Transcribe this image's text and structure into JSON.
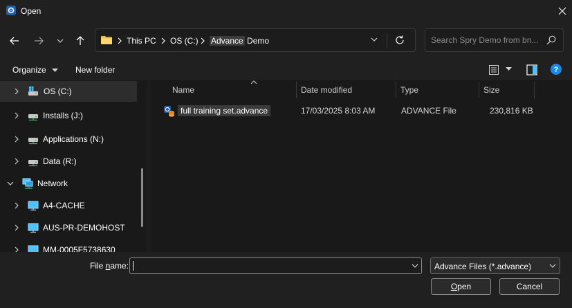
{
  "window": {
    "title": "Open",
    "app_icon": "advance-app-icon",
    "close_icon": "close-icon"
  },
  "nav": {
    "back_icon": "arrow-left-icon",
    "forward_icon": "arrow-right-icon",
    "recent_icon": "chevron-down-icon",
    "up_icon": "arrow-up-icon",
    "breadcrumbs": [
      "This PC",
      "OS (C:)",
      "Advance",
      "Demo"
    ],
    "search_placeholder": "Search Spry Demo from bn..."
  },
  "commands": {
    "organize": "Organize",
    "new_folder": "New folder"
  },
  "sidebar": {
    "items": [
      {
        "label": "OS (C:)",
        "icon": "windows-drive-icon",
        "expanded": false,
        "selected": true
      },
      {
        "label": "Installs (J:)",
        "icon": "network-drive-icon",
        "expanded": false
      },
      {
        "label": "Applications (N:)",
        "icon": "network-drive-icon",
        "expanded": false
      },
      {
        "label": "Data (R:)",
        "icon": "network-drive-icon",
        "expanded": false
      },
      {
        "label": "Network",
        "icon": "network-icon",
        "expanded": true
      },
      {
        "label": "A4-CACHE",
        "icon": "computer-icon",
        "expanded": false
      },
      {
        "label": "AUS-PR-DEMOHOST",
        "icon": "computer-icon",
        "expanded": false
      },
      {
        "label": "MM-0005F5738630",
        "icon": "computer-icon",
        "expanded": false
      }
    ]
  },
  "columns": {
    "name": "Name",
    "date": "Date modified",
    "type": "Type",
    "size": "Size"
  },
  "files": [
    {
      "name": "full training set.advance",
      "date": "17/03/2025 8:03 AM",
      "type": "ADVANCE File",
      "size": "230,816 KB",
      "icon": "advance-file-icon"
    }
  ],
  "footer": {
    "file_name_label_pre": "File ",
    "file_name_label_accel": "n",
    "file_name_label_post": "ame:",
    "file_name_value": "",
    "filter": "Advance Files (*.advance)",
    "open_accel": "O",
    "open_rest": "pen",
    "cancel": "Cancel"
  },
  "colors": {
    "accent": "#4cc2ff",
    "help": "#1e88e5",
    "folder": "#f2c14e"
  }
}
